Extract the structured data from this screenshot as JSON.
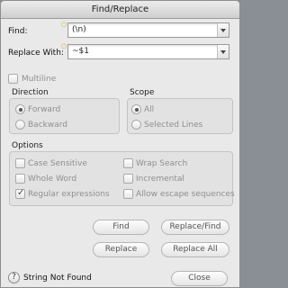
{
  "window": {
    "title": "Find/Replace"
  },
  "find": {
    "label": "Find:",
    "value": "(\\n)"
  },
  "replace": {
    "label": "Replace With:",
    "value": "~$1"
  },
  "multiline": {
    "label": "Multiline",
    "checked": false
  },
  "direction": {
    "title": "Direction",
    "options": [
      {
        "label": "Forward",
        "selected": true
      },
      {
        "label": "Backward",
        "selected": false
      }
    ]
  },
  "scope": {
    "title": "Scope",
    "options": [
      {
        "label": "All",
        "selected": true
      },
      {
        "label": "Selected Lines",
        "selected": false
      }
    ]
  },
  "options": {
    "title": "Options",
    "items": [
      {
        "label": "Case Sensitive",
        "checked": false
      },
      {
        "label": "Wrap Search",
        "checked": false
      },
      {
        "label": "Whole Word",
        "checked": false
      },
      {
        "label": "Incremental",
        "checked": false
      },
      {
        "label": "Regular expressions",
        "checked": true
      },
      {
        "label": "Allow escape sequences",
        "checked": false
      }
    ]
  },
  "buttons": {
    "find": "Find",
    "replace_find": "Replace/Find",
    "replace": "Replace",
    "replace_all": "Replace All",
    "close": "Close"
  },
  "status": {
    "help": "?",
    "text": "String Not Found"
  }
}
